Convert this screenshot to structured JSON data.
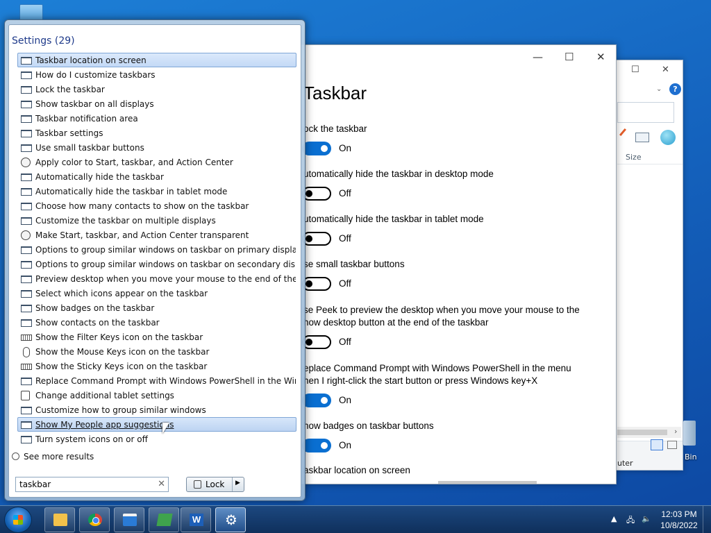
{
  "start_menu": {
    "heading": "Settings (29)",
    "results": [
      {
        "label": "Taskbar location on screen",
        "icon": "monitor-icon"
      },
      {
        "label": "How do I customize taskbars",
        "icon": "monitor-icon"
      },
      {
        "label": "Lock the taskbar",
        "icon": "monitor-icon"
      },
      {
        "label": "Show taskbar on all displays",
        "icon": "monitor-icon"
      },
      {
        "label": "Taskbar notification area",
        "icon": "monitor-icon"
      },
      {
        "label": "Taskbar settings",
        "icon": "monitor-icon"
      },
      {
        "label": "Use small taskbar buttons",
        "icon": "monitor-icon"
      },
      {
        "label": "Apply color to Start, taskbar, and Action Center",
        "icon": "palette-icon"
      },
      {
        "label": "Automatically hide the taskbar",
        "icon": "monitor-icon"
      },
      {
        "label": "Automatically hide the taskbar in tablet mode",
        "icon": "monitor-icon"
      },
      {
        "label": "Choose how many contacts to show on the taskbar",
        "icon": "monitor-icon"
      },
      {
        "label": "Customize the taskbar on multiple displays",
        "icon": "monitor-icon"
      },
      {
        "label": "Make Start, taskbar, and Action Center transparent",
        "icon": "palette-icon"
      },
      {
        "label": "Options to group similar windows on taskbar on primary display",
        "icon": "monitor-icon"
      },
      {
        "label": "Options to group similar windows on taskbar on secondary displays",
        "icon": "monitor-icon"
      },
      {
        "label": "Preview desktop when you move your mouse to the end of the taskbar",
        "icon": "monitor-icon"
      },
      {
        "label": "Select which icons appear on the taskbar",
        "icon": "monitor-icon"
      },
      {
        "label": "Show badges on the taskbar",
        "icon": "monitor-icon"
      },
      {
        "label": "Show contacts on the taskbar",
        "icon": "monitor-icon"
      },
      {
        "label": "Show the Filter Keys icon on the taskbar",
        "icon": "keyboard-icon"
      },
      {
        "label": "Show the Mouse Keys icon on the taskbar",
        "icon": "mouse-icon"
      },
      {
        "label": "Show the Sticky Keys icon on the taskbar",
        "icon": "keyboard-icon"
      },
      {
        "label": "Replace Command Prompt with Windows PowerShell in the Win + X ...",
        "icon": "monitor-icon"
      },
      {
        "label": "Change additional tablet settings",
        "icon": "tablet-icon"
      },
      {
        "label": "Customize how to group similar windows",
        "icon": "monitor-icon"
      },
      {
        "label": "Show My People app suggestions",
        "icon": "monitor-icon"
      },
      {
        "label": "Turn system icons on or off",
        "icon": "monitor-icon"
      }
    ],
    "see_more": "See more results",
    "search_value": "taskbar",
    "lock_label": "Lock"
  },
  "settings_window": {
    "title": "Taskbar",
    "options": [
      {
        "label": "ock the taskbar",
        "state": "On"
      },
      {
        "label": "utomatically hide the taskbar in desktop mode",
        "state": "Off"
      },
      {
        "label": "utomatically hide the taskbar in tablet mode",
        "state": "Off"
      },
      {
        "label": "se small taskbar buttons",
        "state": "Off"
      },
      {
        "label": "se Peek to preview the desktop when you move your mouse to the\nhow desktop button at the end of the taskbar",
        "state": "Off"
      },
      {
        "label": "eplace Command Prompt with Windows PowerShell in the menu\nhen I right-click the start button or press Windows key+X",
        "state": "On"
      },
      {
        "label": "how badges on taskbar buttons",
        "state": "On"
      }
    ],
    "last_label": "askbar location on screen"
  },
  "explorer_window": {
    "column_size": "Size",
    "status_text": "uter"
  },
  "desktop": {
    "bin_label": "Bin"
  },
  "taskbar": {
    "apps": [
      "folder-icon",
      "chrome-icon",
      "store-icon",
      "green-app-icon",
      "word-icon",
      "gear-icon"
    ],
    "time": "12:03 PM",
    "date": "10/8/2022"
  },
  "colors": {
    "toggle_on": "#0a6fd1",
    "selection": "#c3d9f6",
    "desktop": "#1565c0"
  }
}
